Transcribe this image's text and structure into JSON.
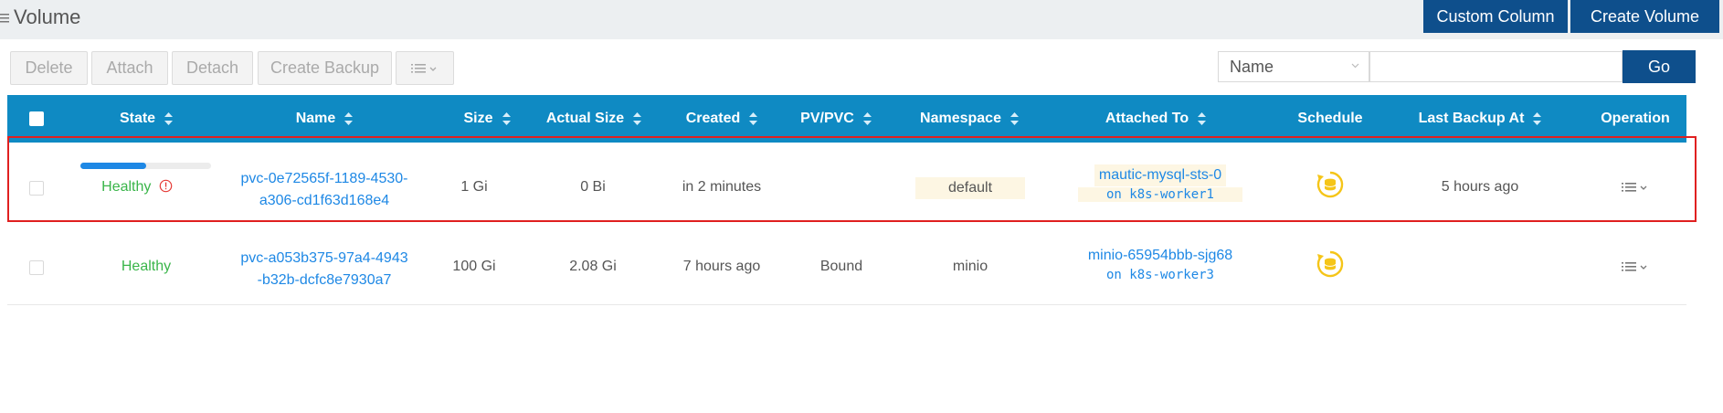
{
  "header": {
    "title": "Volume",
    "custom_column_label": "Custom Column",
    "create_volume_label": "Create Volume"
  },
  "actions": {
    "delete_label": "Delete",
    "attach_label": "Attach",
    "detach_label": "Detach",
    "create_backup_label": "Create Backup"
  },
  "search": {
    "field_selected": "Name",
    "query": "",
    "go_label": "Go"
  },
  "table": {
    "columns": [
      "State",
      "Name",
      "Size",
      "Actual Size",
      "Created",
      "PV/PVC",
      "Namespace",
      "Attached To",
      "Schedule",
      "Last Backup At",
      "Operation"
    ],
    "rows": [
      {
        "progress": 0.5,
        "state": "Healthy",
        "name_line1": "pvc-0e72565f-1189-4530-",
        "name_line2": "a306-cd1f63d168e4",
        "size": "1 Gi",
        "actual_size": "0 Bi",
        "created": "in 2 minutes",
        "pv_pvc": "",
        "namespace": "default",
        "attached_to": "mautic-mysql-sts-0",
        "attached_node": "on k8s-worker1",
        "last_backup": "5 hours ago"
      },
      {
        "state": "Healthy",
        "name_line1": "pvc-a053b375-97a4-4943",
        "name_line2": "-b32b-dcfc8e7930a7",
        "size": "100 Gi",
        "actual_size": "2.08 Gi",
        "created": "7 hours ago",
        "pv_pvc": "Bound",
        "namespace": "minio",
        "attached_to": "minio-65954bbb-sjg68",
        "attached_node": "on k8s-worker3",
        "last_backup": ""
      }
    ]
  },
  "colors": {
    "primary": "#0e4f8c",
    "header_bg": "#0f8ac3",
    "healthy": "#3ab54a",
    "link": "#1e88e5",
    "schedule_icon": "#f5c518",
    "highlight": "#e02020"
  }
}
